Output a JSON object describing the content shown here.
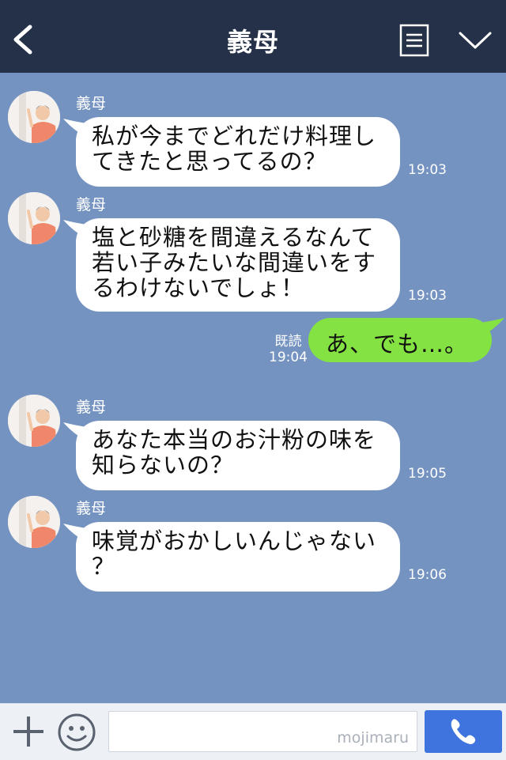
{
  "header": {
    "title": "義母",
    "back_icon": "chevron-left-icon",
    "menu_icon": "document-list-icon",
    "collapse_icon": "chevron-down-icon"
  },
  "messages": [
    {
      "sender": "義母",
      "lines": [
        "私が今までどれだけ料理し",
        "てきたと思ってるの？"
      ],
      "time": "19:03"
    },
    {
      "sender": "義母",
      "lines": [
        "塩と砂糖を間違えるなんて",
        "若い子みたいな間違いをす",
        "るわけないでしょ！"
      ],
      "time": "19:03"
    },
    {
      "sender": "義母",
      "lines": [
        "あなた本当のお汁粉の味を",
        "知らないの？"
      ],
      "time": "19:05"
    },
    {
      "sender": "義母",
      "lines": [
        "味覚がおかしいんじゃない",
        "？"
      ],
      "time": "19:06"
    }
  ],
  "outgoing": {
    "text": "あ、でも…。",
    "read_label": "既読",
    "time": "19:04"
  },
  "input_bar": {
    "plus_icon": "plus-icon",
    "emoji_icon": "smiley-icon",
    "input_value": "",
    "watermark": "mojimaru",
    "call_icon": "phone-icon"
  },
  "colors": {
    "header": "#253148",
    "chat_bg": "#7593c0",
    "outgoing_bubble": "#84e342",
    "call_button": "#3f74de"
  }
}
